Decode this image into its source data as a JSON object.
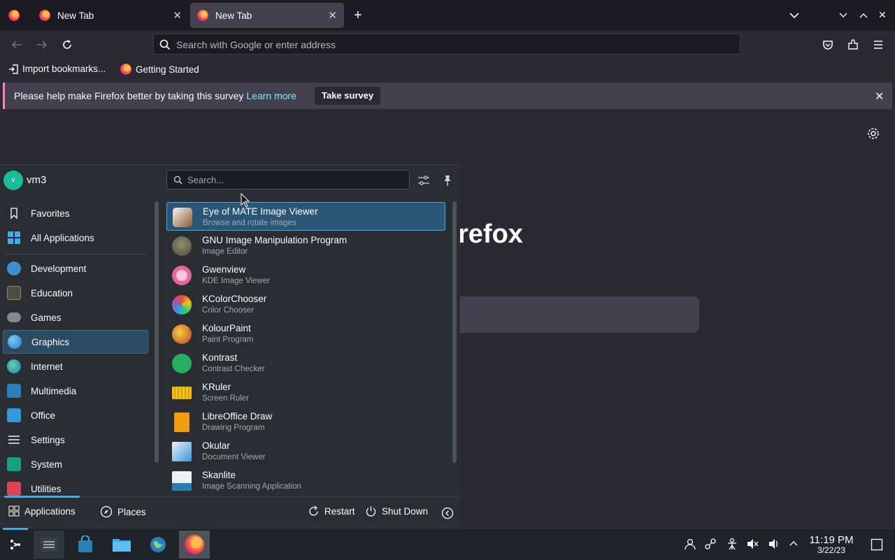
{
  "browser": {
    "tabs": [
      {
        "label": "New Tab"
      },
      {
        "label": "New Tab"
      }
    ],
    "urlbar_placeholder": "Search with Google or enter address",
    "bookmarks": [
      {
        "label": "Import bookmarks..."
      },
      {
        "label": "Getting Started"
      }
    ],
    "survey": {
      "message": "Please help make Firefox better by taking this survey",
      "link": "Learn more",
      "button": "Take survey"
    },
    "logo_text": "refox"
  },
  "launcher": {
    "user": "vm3",
    "avatar_letter": "v",
    "search_placeholder": "Search...",
    "categories": [
      {
        "label": "Favorites",
        "icon": "bookmark-icon"
      },
      {
        "label": "All Applications",
        "icon": "grid-icon"
      },
      {
        "label": "Development",
        "icon": "development-icon"
      },
      {
        "label": "Education",
        "icon": "education-icon"
      },
      {
        "label": "Games",
        "icon": "gamepad-icon"
      },
      {
        "label": "Graphics",
        "icon": "graphics-icon"
      },
      {
        "label": "Internet",
        "icon": "globe-icon"
      },
      {
        "label": "Multimedia",
        "icon": "multimedia-icon"
      },
      {
        "label": "Office",
        "icon": "office-icon"
      },
      {
        "label": "Settings",
        "icon": "settings-icon"
      },
      {
        "label": "System",
        "icon": "system-icon"
      },
      {
        "label": "Utilities",
        "icon": "utilities-icon"
      }
    ],
    "apps": [
      {
        "name": "Eye of MATE Image Viewer",
        "desc": "Browse and rotate images",
        "icon": "image-viewer-icon"
      },
      {
        "name": "GNU Image Manipulation Program",
        "desc": "Image Editor",
        "icon": "gimp-icon"
      },
      {
        "name": "Gwenview",
        "desc": "KDE Image Viewer",
        "icon": "gwenview-icon"
      },
      {
        "name": "KColorChooser",
        "desc": "Color Chooser",
        "icon": "color-chooser-icon"
      },
      {
        "name": "KolourPaint",
        "desc": "Paint Program",
        "icon": "paint-icon"
      },
      {
        "name": "Kontrast",
        "desc": "Contrast Checker",
        "icon": "contrast-icon"
      },
      {
        "name": "KRuler",
        "desc": "Screen Ruler",
        "icon": "ruler-icon"
      },
      {
        "name": "LibreOffice Draw",
        "desc": "Drawing Program",
        "icon": "draw-icon"
      },
      {
        "name": "Okular",
        "desc": "Document Viewer",
        "icon": "document-viewer-icon"
      },
      {
        "name": "Skanlite",
        "desc": "Image Scanning Application",
        "icon": "scanner-icon"
      }
    ],
    "footer": {
      "applications": "Applications",
      "places": "Places",
      "restart": "Restart",
      "shutdown": "Shut Down"
    }
  },
  "taskbar": {
    "time": "11:19 PM",
    "date": "3/22/23"
  },
  "colors": {
    "accent": "#3daee9",
    "survey_link": "#80ebff",
    "survey_stripe": "#ff7ec9"
  }
}
